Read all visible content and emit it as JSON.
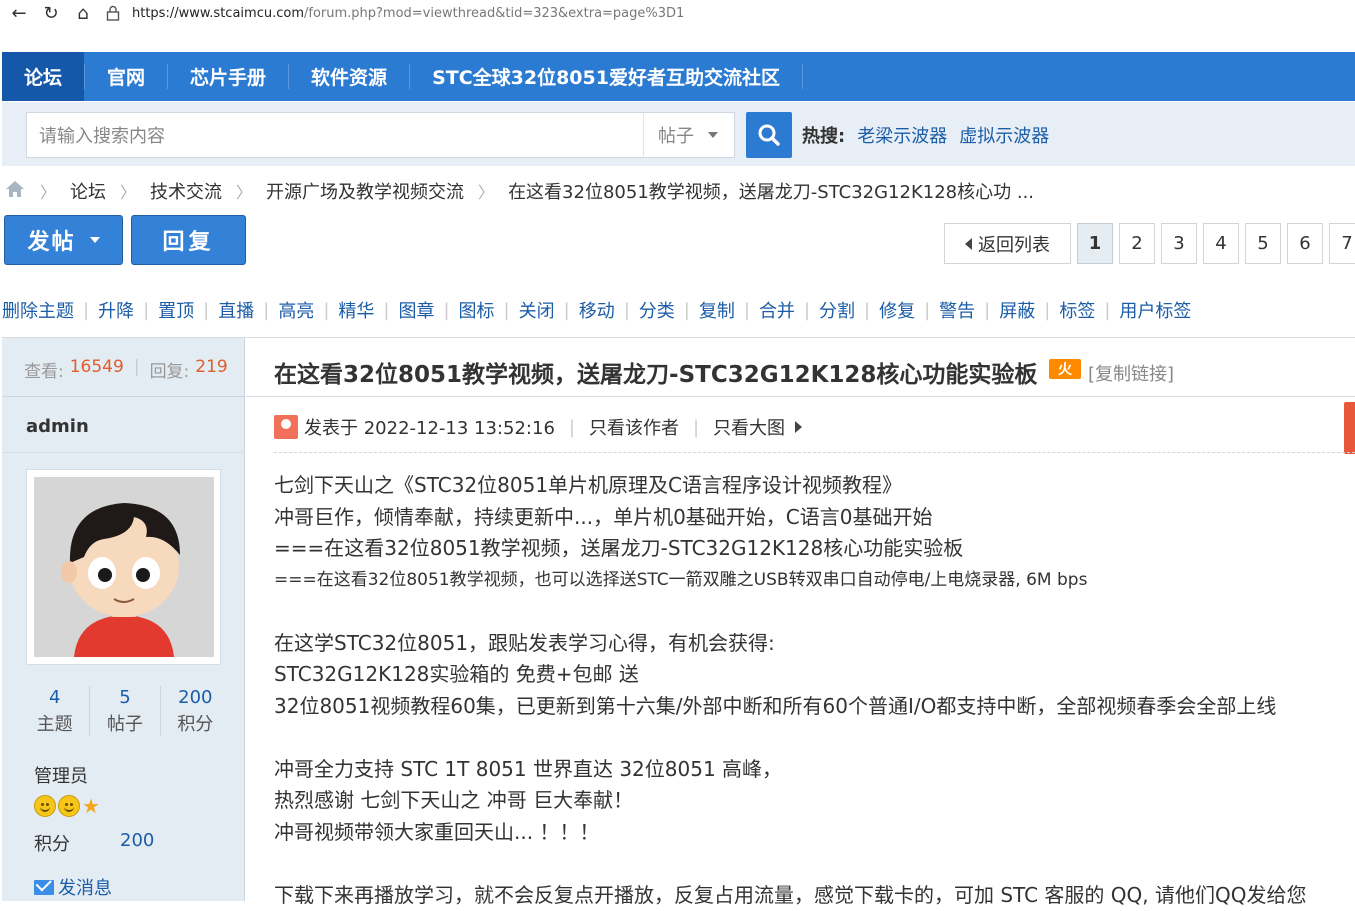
{
  "browser": {
    "url_host": "https://www.stcaimcu.com",
    "url_rest": "/forum.php?mod=viewthread&tid=323&extra=page%3D1"
  },
  "nav": {
    "items": [
      "论坛",
      "官网",
      "芯片手册",
      "软件资源",
      "STC全球32位8051爱好者互助交流社区"
    ]
  },
  "search": {
    "placeholder": "请输入搜索内容",
    "type": "帖子",
    "hot_label": "热搜:",
    "hot_links": [
      "老梁示波器",
      "虚拟示波器"
    ]
  },
  "breadcrumb": [
    "论坛",
    "技术交流",
    "开源广场及教学视频交流",
    "在这看32位8051教学视频，送屠龙刀-STC32G12K128核心功 ..."
  ],
  "actions": {
    "post": "发帖",
    "reply": "回复"
  },
  "pager": {
    "back": "返回列表",
    "pages": [
      "1",
      "2",
      "3",
      "4",
      "5",
      "6",
      "7"
    ],
    "current": "1"
  },
  "mod_tools": [
    "删除主题",
    "升降",
    "置顶",
    "直播",
    "高亮",
    "精华",
    "图章",
    "图标",
    "关闭",
    "移动",
    "分类",
    "复制",
    "合并",
    "分割",
    "修复",
    "警告",
    "屏蔽",
    "标签",
    "用户标签"
  ],
  "thread": {
    "views_label": "查看:",
    "views": "16549",
    "replies_label": "回复:",
    "replies": "219",
    "title": "在这看32位8051教学视频，送屠龙刀-STC32G12K128核心功能实验板",
    "hot_badge": "火",
    "copy_link": "[复制链接]"
  },
  "author": {
    "name": "admin",
    "topics": "4",
    "topics_label": "主题",
    "posts": "5",
    "posts_label": "帖子",
    "credits": "200",
    "credits_label": "积分",
    "role": "管理员",
    "points_label": "积分",
    "points": "200",
    "send_msg": "发消息"
  },
  "post": {
    "posted_at": "发表于 2022-12-13 13:52:16",
    "only_author": "只看该作者",
    "only_big_image": "只看大图",
    "lines": [
      "七剑下天山之《STC32位8051单片机原理及C语言程序设计视频教程》",
      "冲哥巨作，倾情奉献，持续更新中...，单片机0基础开始，C语言0基础开始",
      "===在这看32位8051教学视频，送屠龙刀-STC32G12K128核心功能实验板",
      "===在这看32位8051教学视频，也可以选择送STC一箭双雕之USB转双串口自动停电/上电烧录器, 6M bps",
      "在这学STC32位8051，跟贴发表学习心得，有机会获得:",
      "STC32G12K128实验箱的 免费+包邮 送",
      "32位8051视频教程60集，已更新到第十六集/外部中断和所有60个普通I/O都支持中断，全部视频春季会全部上线",
      "冲哥全力支持 STC 1T 8051 世界直达 32位8051 高峰，",
      "热烈感谢 七剑下天山之 冲哥 巨大奉献！",
      "冲哥视频带领大家重回天山...  ！！！",
      "下载下来再播放学习，就不会反复点开播放，反复占用流量，感觉下载卡的，可加 STC 客服的 QQ, 请他们QQ发给您"
    ]
  }
}
